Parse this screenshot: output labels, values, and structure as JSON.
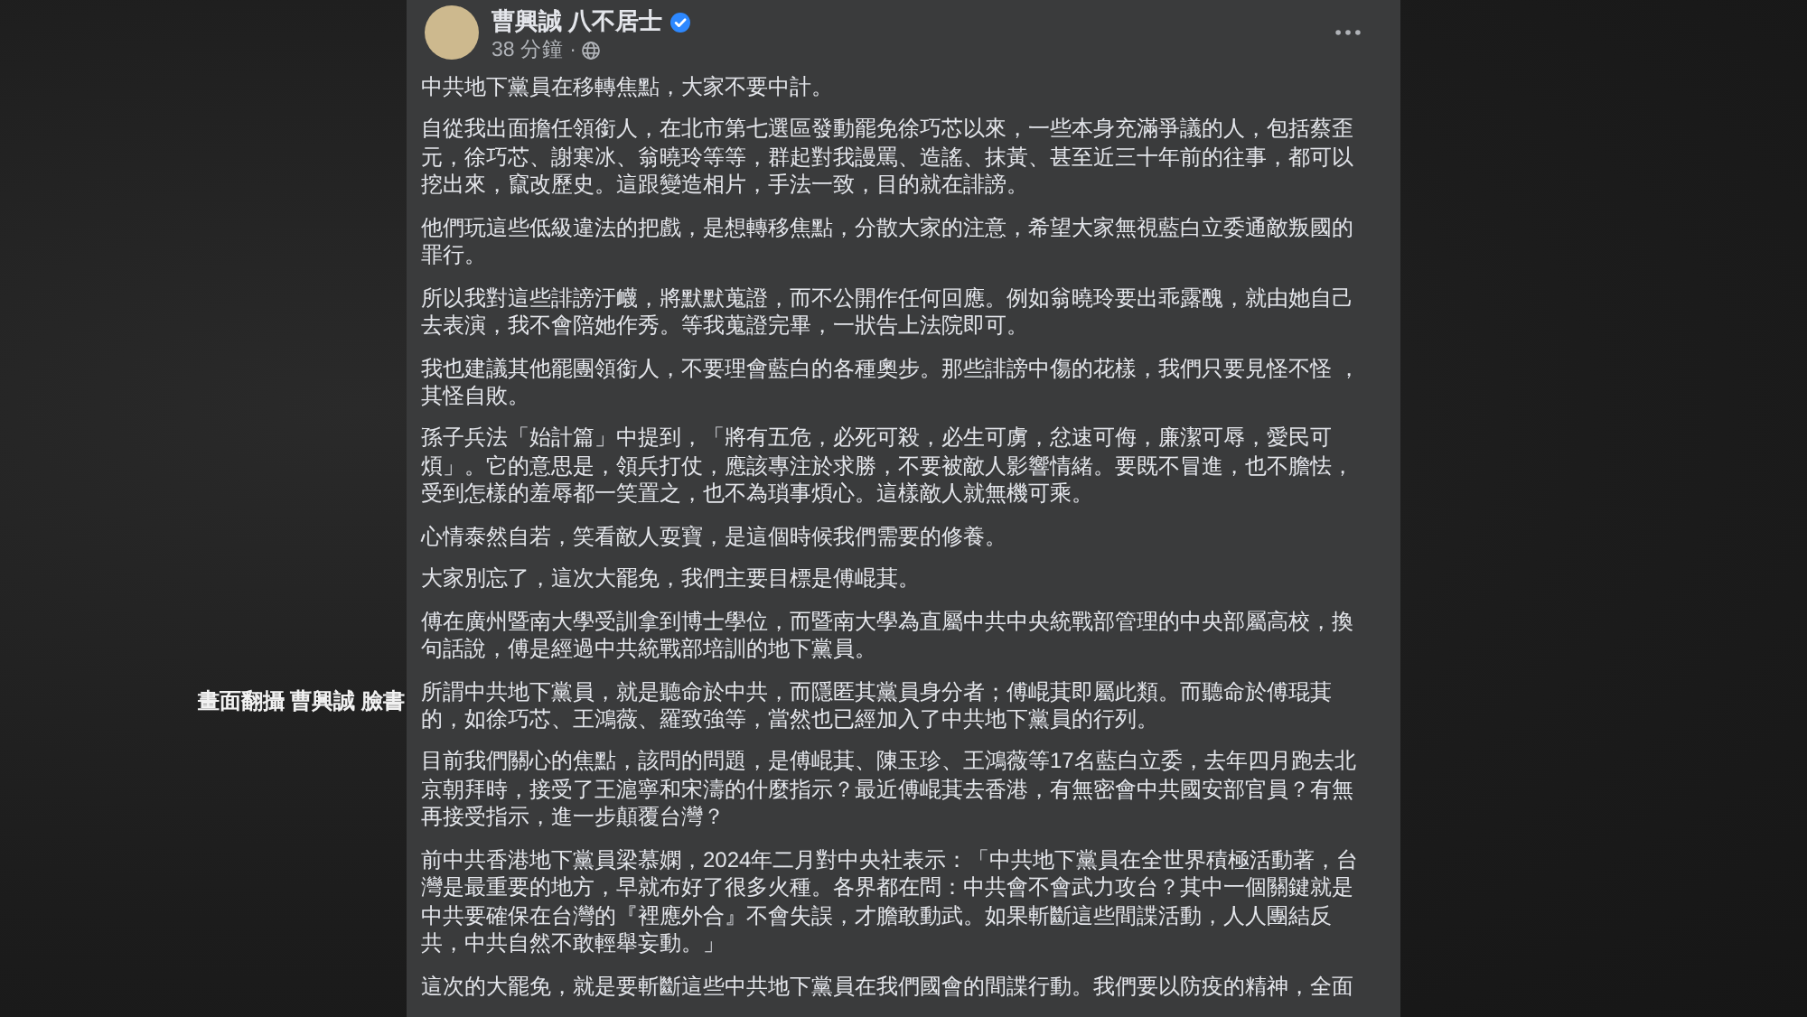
{
  "caption": "畫面翻攝 曹興誠 臉書",
  "post": {
    "author": "曹興誠 八不居士",
    "verified": true,
    "time": "38 分鐘 ·",
    "paragraphs": [
      "中共地下黨員在移轉焦點，大家不要中計。",
      "自從我出面擔任領銜人，在北市第七選區發動罷免徐巧芯以來，一些本身充滿爭議的人，包括蔡歪元，徐巧芯、謝寒冰、翁曉玲等等，群起對我謾罵、造謠、抹黃、甚至近三十年前的往事，都可以挖出來，竄改歷史。這跟變造相片，手法一致，目的就在誹謗。",
      "他們玩這些低級違法的把戲，是想轉移焦點，分散大家的注意，希望大家無視藍白立委通敵叛國的罪行。",
      "所以我對這些誹謗汙衊，將默默蒐證，而不公開作任何回應。例如翁曉玲要出乖露醜，就由她自己去表演，我不會陪她作秀。等我蒐證完畢，一狀告上法院即可。",
      "我也建議其他罷團領銜人，不要理會藍白的各種奧步。那些誹謗中傷的花樣，我們只要見怪不怪 ，其怪自敗。",
      "孫子兵法「始計篇」中提到，「將有五危，必死可殺，必生可虜，忿速可侮，廉潔可辱，愛民可煩」。它的意思是，領兵打仗，應該專注於求勝，不要被敵人影響情緒。要既不冒進，也不膽怯，受到怎樣的羞辱都一笑置之，也不為瑣事煩心。這樣敵人就無機可乘。",
      "心情泰然自若，笑看敵人耍寶，是這個時候我們需要的修養。",
      "大家別忘了，這次大罷免，我們主要目標是傅崐萁。",
      "傅在廣州暨南大學受訓拿到博士學位，而暨南大學為直屬中共中央統戰部管理的中央部屬高校，換句話說，傅是經過中共統戰部培訓的地下黨員。",
      "所謂中共地下黨員，就是聽命於中共，而隱匿其黨員身分者；傅崐萁即屬此類。而聽命於傅琨萁的，如徐巧芯、王鴻薇、羅致強等，當然也已經加入了中共地下黨員的行列。",
      "目前我們關心的焦點，該問的問題，是傅崐萁、陳玉珍、王鴻薇等17名藍白立委，去年四月跑去北京朝拜時，接受了王滬寧和宋濤的什麼指示？最近傅崐萁去香港，有無密會中共國安部官員？有無再接受指示，進一步顛覆台灣？",
      "前中共香港地下黨員梁慕嫻，2024年二月對中央社表示：「中共地下黨員在全世界積極活動著，台灣是最重要的地方，早就布好了很多火種。各界都在問：中共會不會武力攻台？其中一個關鍵就是中共要確保在台灣的『裡應外合』不會失誤，才膽敢動武。如果斬斷這些間諜活動，人人團結反共，中共自然不敢輕舉妄動。」",
      "這次的大罷免，就是要斬斷這些中共地下黨員在我們國會的間諜行動。我們要以防疫的精神，全面"
    ]
  }
}
